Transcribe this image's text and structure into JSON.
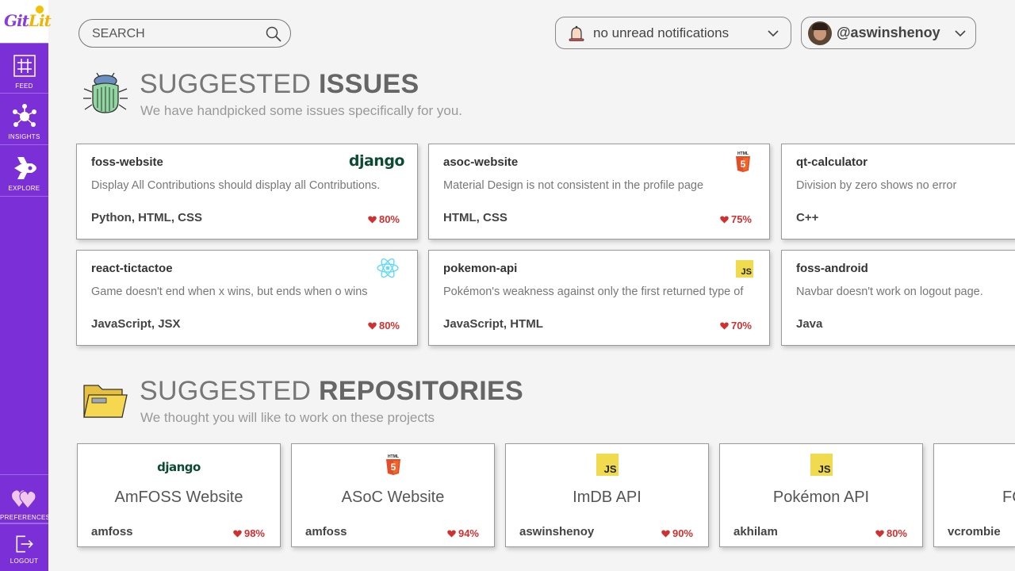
{
  "app": {
    "logo_main": "Git",
    "logo_accent": "Lit"
  },
  "sidebar": {
    "items": [
      {
        "label": "FEED",
        "icon": "hashtag-icon"
      },
      {
        "label": "INSIGHTS",
        "icon": "network-icon"
      },
      {
        "label": "EXPLORE",
        "icon": "rocket-icon"
      },
      {
        "label": "PREFERENCES",
        "icon": "hearts-icon"
      },
      {
        "label": "LOGOUT",
        "icon": "logout-icon"
      }
    ]
  },
  "header": {
    "search_placeholder": "SEARCH",
    "notifications": "no unread notifications",
    "username": "@aswinshenoy"
  },
  "issues_section": {
    "title_light": "SUGGESTED",
    "title_bold": "ISSUES",
    "subtitle": "We have handpicked some issues specifically for you."
  },
  "issues": [
    {
      "repo": "foss-website",
      "desc": "Display All Contributions should display all Contributions.",
      "langs": "Python, HTML, CSS",
      "match": "80%",
      "logo": "django"
    },
    {
      "repo": "asoc-website",
      "desc": "Material Design is not consistent in the profile page",
      "langs": "HTML, CSS",
      "match": "75%",
      "logo": "html5"
    },
    {
      "repo": "qt-calculator",
      "desc": "Division by zero shows no error",
      "langs": "C++",
      "match": "",
      "logo": ""
    },
    {
      "repo": "react-tictactoe",
      "desc": "Game doesn't end when x wins, but ends when o wins",
      "langs": "JavaScript, JSX",
      "match": "80%",
      "logo": "react"
    },
    {
      "repo": "pokemon-api",
      "desc": "Pokémon's weakness against only the first returned type of",
      "langs": "JavaScript, HTML",
      "match": "70%",
      "logo": "js"
    },
    {
      "repo": "foss-android",
      "desc": "Navbar doesn't work on logout page.",
      "langs": "Java",
      "match": "",
      "logo": ""
    }
  ],
  "repos_section": {
    "title_light": "SUGGESTED",
    "title_bold": "REPOSITORIES",
    "subtitle": "We thought you will like to work on these projects"
  },
  "repos": [
    {
      "name": "AmFOSS Website",
      "owner": "amfoss",
      "match": "98%",
      "logo": "django"
    },
    {
      "name": "ASoC Website",
      "owner": "amfoss",
      "match": "94%",
      "logo": "html5"
    },
    {
      "name": "ImDB API",
      "owner": "aswinshenoy",
      "match": "90%",
      "logo": "js"
    },
    {
      "name": "Pokémon API",
      "owner": "akhilam",
      "match": "80%",
      "logo": "js"
    },
    {
      "name": "FC",
      "owner": "vcrombie",
      "match": "",
      "logo": ""
    }
  ],
  "logo_text": {
    "django": "django",
    "html5": "HTML",
    "js": "JS"
  },
  "colors": {
    "sidebar": "#7b2fd6",
    "match": "#d03030",
    "django": "#0c4b33",
    "js": "#f0db4f",
    "html5": "#e44d26",
    "react": "#61dafb"
  }
}
